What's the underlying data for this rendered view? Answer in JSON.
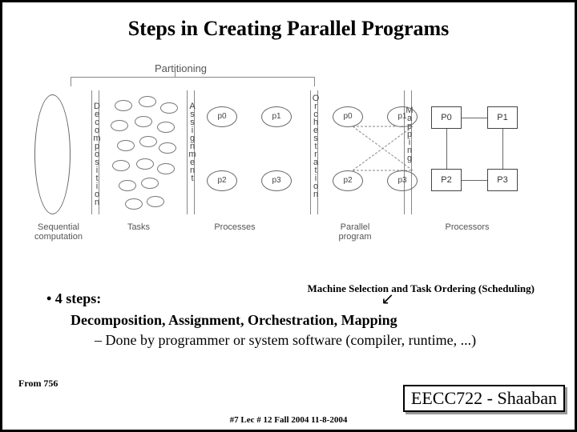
{
  "title": "Steps in Creating  Parallel Programs",
  "diagram": {
    "partition_label": "Partitioning",
    "stage_labels": {
      "decomposition": "Decomposition",
      "assignment": "Assignment",
      "orchestration": "Orchestration",
      "mapping": "Mapping"
    },
    "procs": {
      "p0": "p0",
      "p1": "p1",
      "p2": "p2",
      "p3": "p3"
    },
    "cpus": {
      "P0": "P0",
      "P1": "P1",
      "P2": "P2",
      "P3": "P3"
    },
    "bottom_labels": {
      "seq": "Sequential computation",
      "tasks": "Tasks",
      "procs": "Processes",
      "par": "Parallel program",
      "cpus": "Processors"
    }
  },
  "annotation": "Machine Selection and Task Ordering (Scheduling)",
  "bullets": {
    "heading": "•   4 steps:",
    "line1": "Decomposition, Assignment, Orchestration, Mapping",
    "line2": "–   Done by programmer or system software (compiler, runtime, ...)"
  },
  "from": "From 756",
  "course_tag": "EECC722 - Shaaban",
  "footer": "#7   Lec # 12   Fall 2004  11-8-2004"
}
